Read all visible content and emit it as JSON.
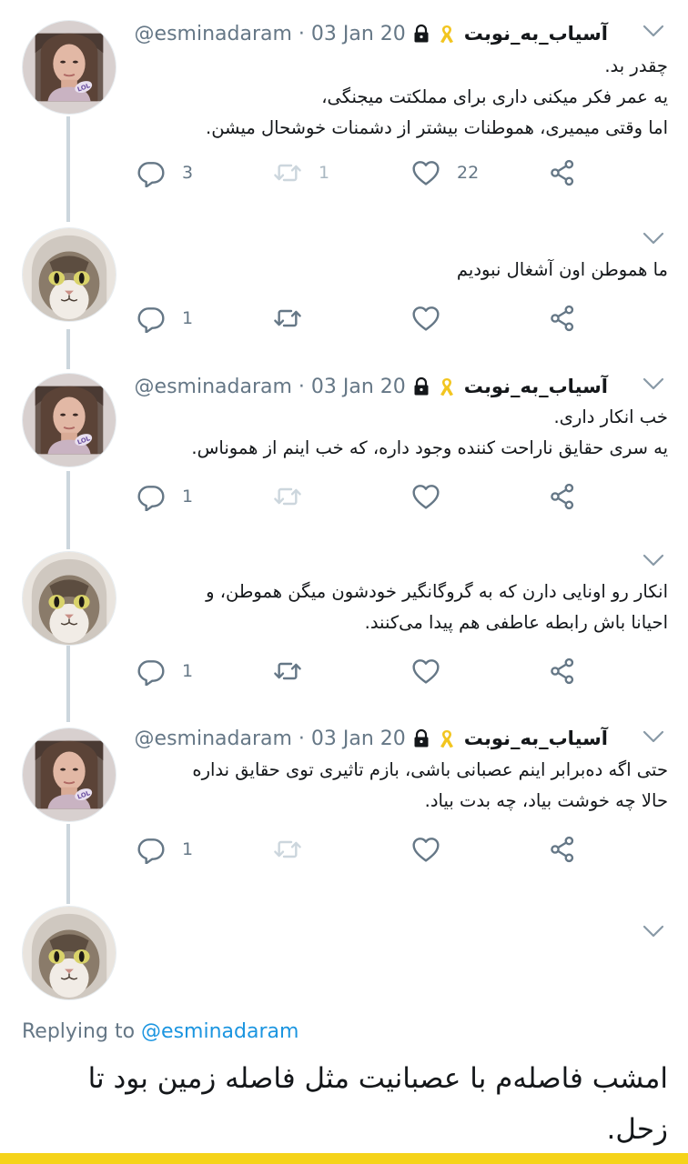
{
  "colors": {
    "text_primary": "#14171a",
    "text_secondary": "#657786",
    "link": "#1b95e0",
    "thread_line": "#ccd6dd",
    "bottom_bar": "#f5d31a"
  },
  "icons": {
    "reply": "reply-icon",
    "retweet": "retweet-icon",
    "like": "heart-icon",
    "share": "share-icon",
    "caret": "chevron-down-icon",
    "lock": "lock-icon",
    "ribbon": "ribbon-icon"
  },
  "tweets": [
    {
      "display_name": "آسیاب_به_نوبت",
      "handle_date": "@esminadaram · 03 Jan 20",
      "lines": [
        "چقدر بد.",
        "یه عمر فکر میکنی داری برای مملکتت میجنگی،",
        "اما وقتی میمیری، هموطنات بیشتر از دشمنات خوشحال میشن."
      ],
      "reply_count": "3",
      "retweet_count": "1",
      "like_count": "22"
    },
    {
      "lines": [
        "ما هموطن اون آشغال نبودیم"
      ],
      "reply_count": "1"
    },
    {
      "display_name": "آسیاب_به_نوبت",
      "handle_date": "@esminadaram · 03 Jan 20",
      "lines": [
        "خب انکار داری.",
        "یه سری حقایق ناراحت کننده وجود داره، که خب اینم از هموناس."
      ],
      "reply_count": "1"
    },
    {
      "lines": [
        "انکار رو اونایی دارن که به گروگانگیر خودشون میگن هموطن، و",
        "احیانا باش رابطه عاطفی هم پیدا می‌کنند."
      ],
      "reply_count": "1"
    },
    {
      "display_name": "آسیاب_به_نوبت",
      "handle_date": "@esminadaram · 03 Jan 20",
      "lines": [
        "حتی اگه ده‌برابر اینم عصبانی باشی، بازم تاثیری توی حقایق نداره",
        "حالا چه خوشت بیاد، چه بدت بیاد."
      ],
      "reply_count": "1"
    }
  ],
  "main_tweet": {
    "replying_prefix": "Replying to",
    "replying_mention": "@esminadaram",
    "lines": [
      "امشب فاصله‌م با عصبانیت مثل فاصله زمین بود تا",
      "زحل."
    ]
  }
}
